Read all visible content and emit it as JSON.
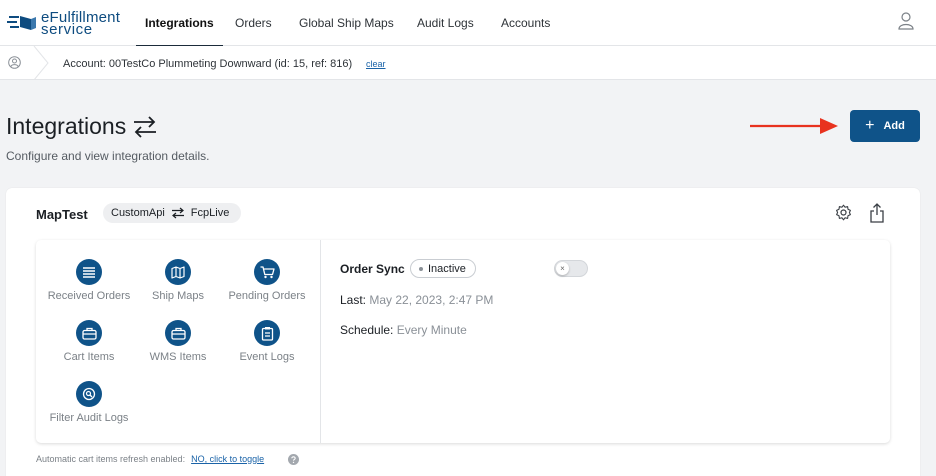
{
  "brand": {
    "line1": "eFulfillment",
    "line2": "service"
  },
  "nav": {
    "tabs": [
      {
        "label": "Integrations",
        "active": true
      },
      {
        "label": "Orders"
      },
      {
        "label": "Global Ship Maps"
      },
      {
        "label": "Audit Logs"
      },
      {
        "label": "Accounts"
      }
    ]
  },
  "account": {
    "text": "Account: 00TestCo Plummeting Downward (id: 15, ref: 816)",
    "clear_label": "clear"
  },
  "page": {
    "title": "Integrations",
    "subtitle": "Configure and view integration details.",
    "add_label": "Add"
  },
  "integration": {
    "name": "MapTest",
    "source": "CustomApi",
    "target": "FcpLive",
    "tiles": [
      {
        "label": "Received Orders",
        "icon": "list-icon"
      },
      {
        "label": "Ship Maps",
        "icon": "map-icon"
      },
      {
        "label": "Pending Orders",
        "icon": "cart-icon"
      },
      {
        "label": "Cart Items",
        "icon": "briefcase-icon"
      },
      {
        "label": "WMS Items",
        "icon": "briefcase-icon"
      },
      {
        "label": "Event Logs",
        "icon": "clipboard-icon"
      },
      {
        "label": "Filter Audit Logs",
        "icon": "search-icon"
      }
    ],
    "order_sync": {
      "title": "Order Sync",
      "status": "Inactive",
      "last_label": "Last:",
      "last_value": "May 22, 2023, 2:47 PM",
      "schedule_label": "Schedule:",
      "schedule_value": "Every Minute"
    }
  },
  "footer": {
    "text": "Automatic cart items refresh enabled:",
    "link": "NO, click to toggle"
  },
  "colors": {
    "primary": "#0f5389",
    "annotation_arrow": "#e8321e"
  }
}
